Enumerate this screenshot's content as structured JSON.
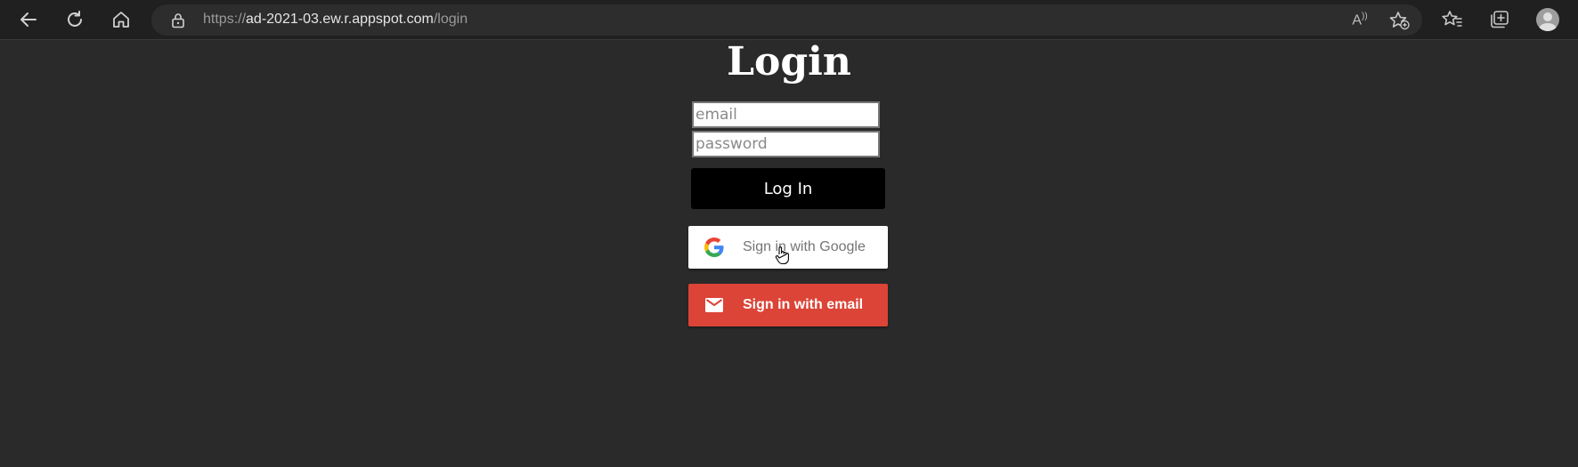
{
  "browser": {
    "url_scheme": "https://",
    "url_host": "ad-2021-03.ew.r.appspot.com",
    "url_path": "/login",
    "read_aloud_label": "A",
    "icons": {
      "back": "back-arrow-icon",
      "refresh": "refresh-icon",
      "home": "home-icon",
      "lock": "lock-icon",
      "read_aloud": "read-aloud-icon",
      "add_favorite": "add-favorite-icon",
      "favorites": "favorites-icon",
      "collections": "collections-icon",
      "profile": "profile-avatar-icon"
    }
  },
  "login": {
    "title": "Login",
    "email_placeholder": "email",
    "password_placeholder": "password",
    "submit_label": "Log In"
  },
  "providers": {
    "google_label": "Sign in with Google",
    "email_label": "Sign in with email",
    "email_color": "#db4437"
  }
}
